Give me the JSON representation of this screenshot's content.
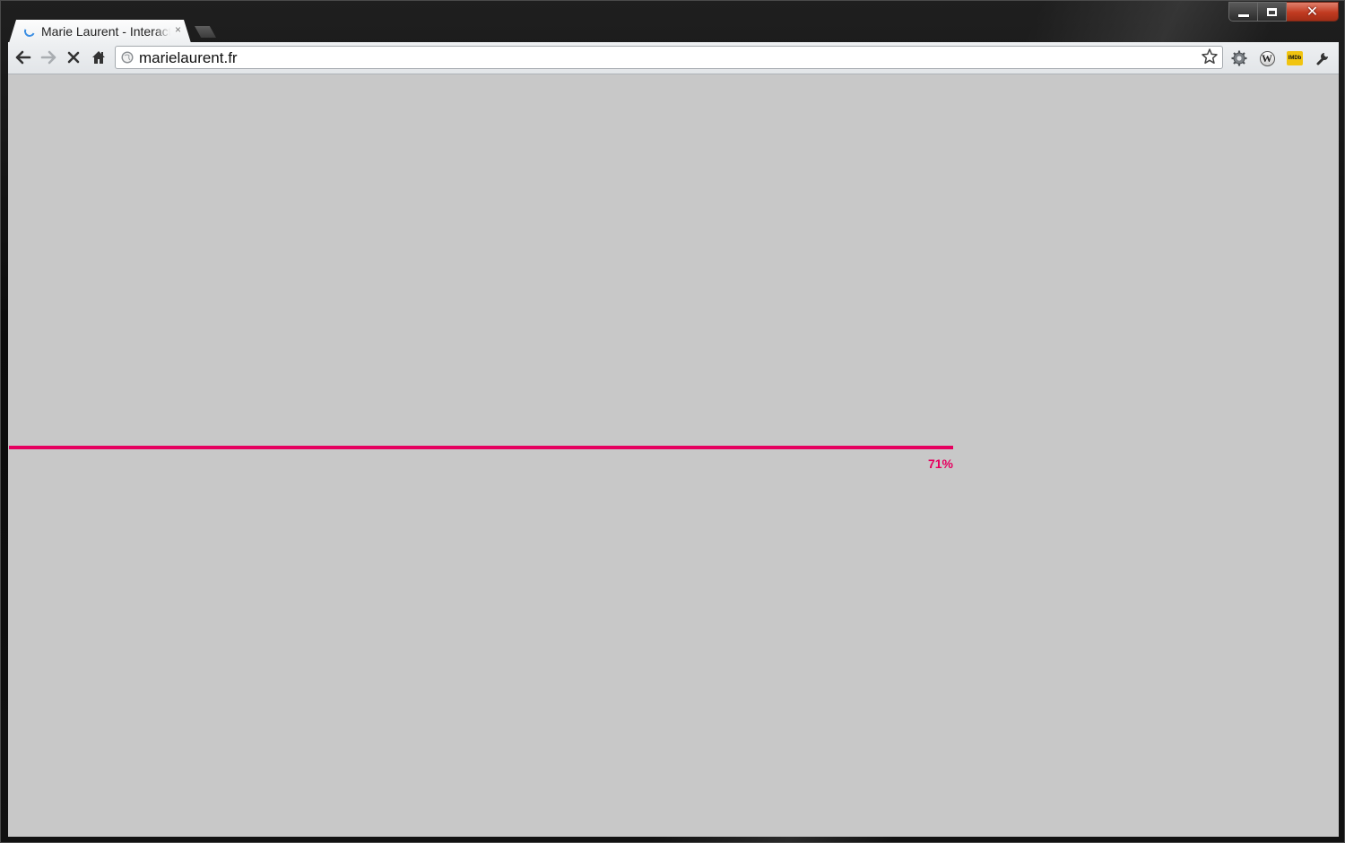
{
  "window": {
    "minimize_icon": "minimize-icon",
    "maximize_icon": "maximize-icon",
    "close_icon": "close-icon",
    "close_glyph": "✕"
  },
  "tabs": [
    {
      "title": "Marie Laurent - Interactive",
      "loading": true,
      "close_glyph": "×"
    }
  ],
  "toolbar": {
    "back_icon": "back-arrow-icon",
    "forward_icon": "forward-arrow-icon",
    "stop_icon": "stop-icon",
    "home_icon": "home-icon",
    "url": "marielaurent.fr",
    "bookmark_icon": "star-icon",
    "extensions": [
      {
        "name": "gear-extension-icon"
      },
      {
        "name": "wikipedia-extension-icon",
        "label": "W"
      },
      {
        "name": "imdb-extension-icon",
        "label": "IMDb"
      }
    ],
    "menu_icon": "wrench-icon"
  },
  "page": {
    "background": "#c8c8c8",
    "accent": "#e6005f",
    "progress": 0.71,
    "progress_label": "71%"
  }
}
